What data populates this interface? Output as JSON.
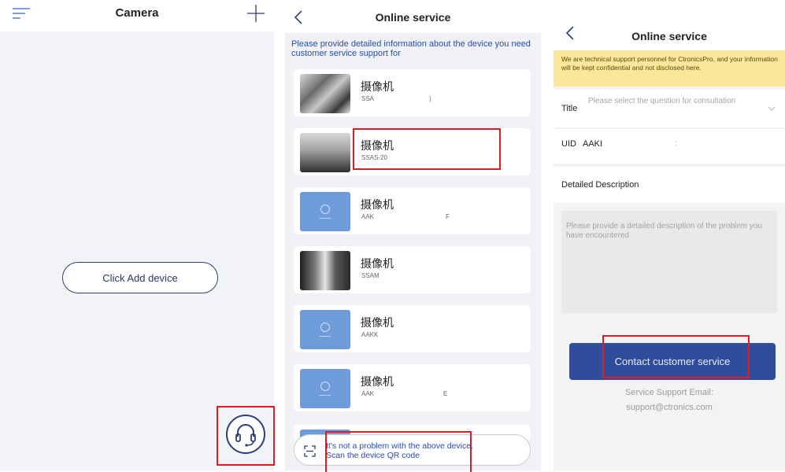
{
  "camera_screen": {
    "title": "Camera",
    "add_device_label": "Click Add device",
    "icons": {
      "menu": "menu-lines-icon",
      "add": "plus-icon",
      "support": "headset-icon"
    }
  },
  "device_list_screen": {
    "title": "Online service",
    "instruction": "Please provide detailed information about the device you need customer service support for",
    "devices": [
      {
        "name": "摄像机",
        "id": "SSA",
        "suffix": ")"
      },
      {
        "name": "摄像机",
        "id": "SSAS-20",
        "suffix": ""
      },
      {
        "name": "摄像机",
        "id": "AAK",
        "suffix": "F"
      },
      {
        "name": "摄像机",
        "id": "SSAM",
        "suffix": ""
      },
      {
        "name": "摄像机",
        "id": "AAKK",
        "suffix": ""
      },
      {
        "name": "摄像机",
        "id": "AAK",
        "suffix": "E"
      }
    ],
    "qr_prompt_line1": "It's not a problem with the above device.",
    "qr_prompt_line2": "Scan the device QR code"
  },
  "service_form_screen": {
    "title": "Online service",
    "notice": "We are technical support personnel for CtronicsPro, and your information will be kept confidential and not disclosed here.",
    "title_label": "Title",
    "title_placeholder": "Please select the question for consultation",
    "uid_label": "UID",
    "uid_value": "AAKI",
    "uid_suffix": ":",
    "description_label": "Detailed Description",
    "description_placeholder": "Please provide a detailed description of the problem you have encountered",
    "contact_button": "Contact customer service",
    "email_line1": "Service Support Email:",
    "email_line2": "support@ctronics.com"
  },
  "colors": {
    "accent_blue": "#304d9c",
    "link_blue": "#2a4ba8",
    "highlight_red": "#e01b24",
    "notice_yellow": "#fbe79a"
  }
}
